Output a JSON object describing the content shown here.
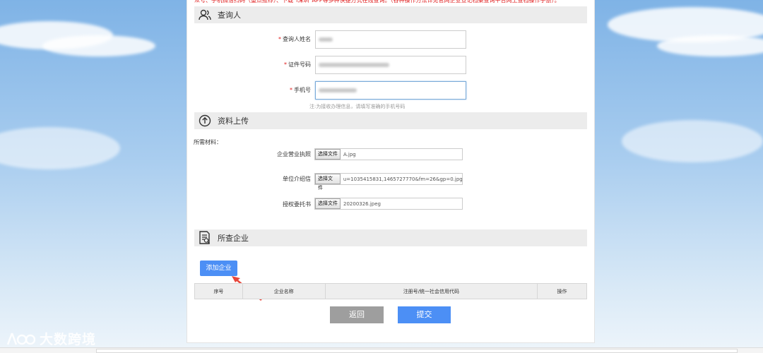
{
  "notice": "众号、手机微信扫码（重点推荐）、下载“i深圳”APP等多种快捷方式在线查询。（各种操作方法详见官网企业登记档案查询平台网上查档操作手册）。",
  "sections": {
    "inquirer": "查询人",
    "upload": "资料上传",
    "company": "所查企业"
  },
  "form": {
    "name_label": "查询人姓名",
    "id_label": "证件号码",
    "phone_label": "手机号",
    "required_mark": "*",
    "phone_hint": "注:为接收办理信息，请填写准确的手机号码"
  },
  "upload": {
    "materials_title": "所需材料：",
    "choose_file_label": "选择文件",
    "items": [
      {
        "label": "企业营业执照",
        "file": "A.jpg"
      },
      {
        "label": "单位介绍信",
        "file": "u=1035415831,1465727770&fm=26&gp=0.jpg"
      },
      {
        "label": "授权委托书",
        "file": "20200326.jpeg"
      }
    ]
  },
  "company": {
    "add_button": "添加企业",
    "columns": [
      "序号",
      "企业名称",
      "注册号/统一社会信用代码",
      "操作"
    ]
  },
  "actions": {
    "back": "返回",
    "submit": "提交"
  },
  "watermark": "大数跨境",
  "colors": {
    "primary": "#4c8ff5",
    "notice_red": "#e02020",
    "back_gray": "#9e9e9e",
    "arrow_red": "#e8473b"
  }
}
